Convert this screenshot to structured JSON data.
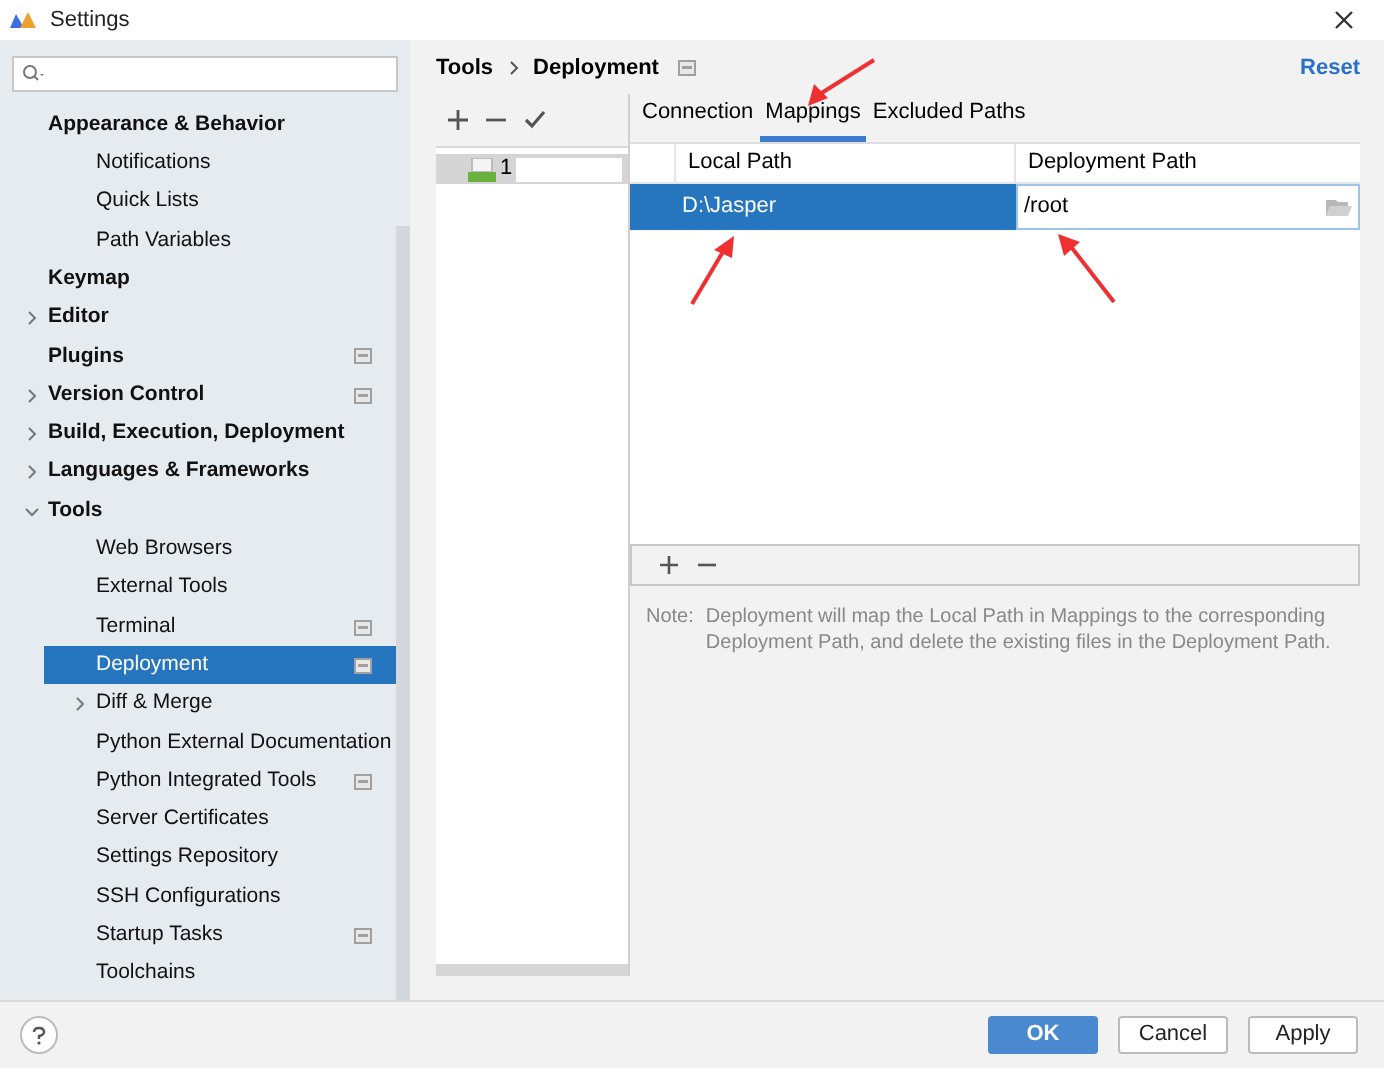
{
  "window": {
    "title": "Settings"
  },
  "sidebar": {
    "items": [
      {
        "label": "Appearance & Behavior",
        "children": [
          {
            "label": "Notifications",
            "selected": false
          },
          {
            "label": "Quick Lists",
            "selected": false
          },
          {
            "label": "Path Variables",
            "selected": false
          }
        ]
      },
      {
        "label": "Keymap",
        "selected": false
      },
      {
        "label": "Editor",
        "expanded": false,
        "selected": false
      },
      {
        "label": "Plugins",
        "selected": false,
        "project": true
      },
      {
        "label": "Version Control",
        "expanded": false,
        "selected": false,
        "project": true
      },
      {
        "label": "Build, Execution, Deployment",
        "expanded": false,
        "selected": false
      },
      {
        "label": "Languages & Frameworks",
        "expanded": false,
        "selected": false
      },
      {
        "label": "Tools",
        "expanded": true,
        "selected": false,
        "children": [
          {
            "label": "Web Browsers",
            "selected": false
          },
          {
            "label": "External Tools",
            "selected": false
          },
          {
            "label": "Terminal",
            "selected": false,
            "project": true
          },
          {
            "label": "Deployment",
            "selected": true,
            "project": true
          },
          {
            "label": "Diff & Merge",
            "expanded": false,
            "selected": false
          },
          {
            "label": "Python External Documentation",
            "selected": false
          },
          {
            "label": "Python Integrated Tools",
            "selected": false,
            "project": true
          },
          {
            "label": "Server Certificates",
            "selected": false
          },
          {
            "label": "Settings Repository",
            "selected": false
          },
          {
            "label": "SSH Configurations",
            "selected": false
          },
          {
            "label": "Startup Tasks",
            "selected": false,
            "project": true
          },
          {
            "label": "Toolchains",
            "selected": false
          }
        ]
      }
    ]
  },
  "breadcrumb": [
    "Tools",
    "Deployment"
  ],
  "reset": "Reset",
  "servers": [
    {
      "label": "1",
      "selected": true
    }
  ],
  "tabs": [
    {
      "label": "Connection",
      "selected": false
    },
    {
      "label": "Mappings",
      "selected": true
    },
    {
      "label": "Excluded Paths",
      "selected": false
    }
  ],
  "table": {
    "columns": [
      "Local Path",
      "Deployment Path"
    ],
    "rows": [
      {
        "local": "D:\\Jasper",
        "deployment": "/root",
        "selected": true
      }
    ]
  },
  "note": {
    "label": "Note:",
    "text": "Deployment will map the Local Path in Mappings to the corresponding Deployment Path, and delete the existing files in the Deployment Path."
  },
  "buttons": [
    {
      "label": "OK",
      "kind": "primary"
    },
    {
      "label": "Cancel",
      "kind": "default"
    },
    {
      "label": "Apply",
      "kind": "default"
    }
  ]
}
